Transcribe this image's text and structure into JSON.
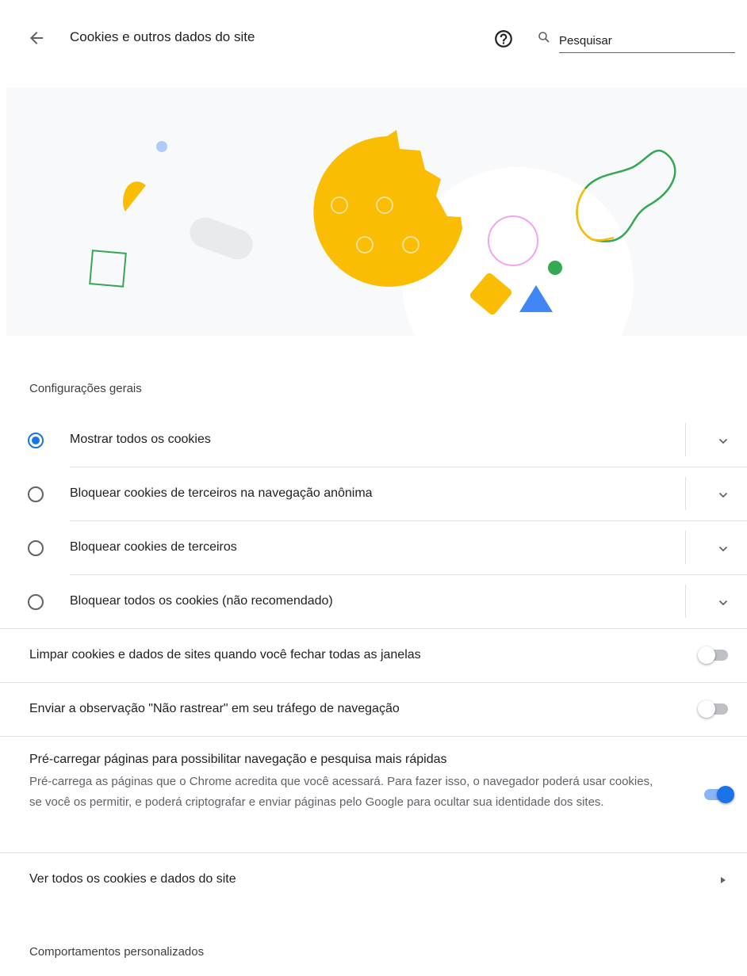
{
  "header": {
    "title": "Cookies e outros dados do site",
    "search_placeholder": "Pesquisar",
    "back_icon": "arrow-left-icon",
    "help_icon": "help-circle-icon",
    "search_icon": "search-icon"
  },
  "colors": {
    "accent": "#1a73e8",
    "yellow": "#fbbc04",
    "green": "#34a853",
    "pink": "#f0a3f0",
    "light_blue": "#aecbfa",
    "banner_bg": "#f8f9fa"
  },
  "general": {
    "title": "Configurações gerais",
    "options": [
      {
        "label": "Mostrar todos os cookies",
        "checked": true
      },
      {
        "label": "Bloquear cookies de terceiros na navegação anônima",
        "checked": false
      },
      {
        "label": "Bloquear cookies de terceiros",
        "checked": false
      },
      {
        "label": "Bloquear todos os cookies (não recomendado)",
        "checked": false
      }
    ]
  },
  "toggles": [
    {
      "label": "Limpar cookies e dados de sites quando você fechar todas as janelas",
      "on": false
    },
    {
      "label": "Enviar a observação \"Não rastrear\" em seu tráfego de navegação",
      "on": false
    },
    {
      "label": "Pré-carregar páginas para possibilitar navegação e pesquisa mais rápidas",
      "description": "Pré-carrega as páginas que o Chrome acredita que você acessará. Para fazer isso, o navegador poderá usar cookies, se você os permitir, e poderá criptografar e enviar páginas pelo Google para ocultar sua identidade dos sites.",
      "on": true
    }
  ],
  "view_all": {
    "label": "Ver todos os cookies e dados do site",
    "icon": "triangle-right-icon"
  },
  "custom": {
    "title": "Comportamentos personalizados"
  }
}
